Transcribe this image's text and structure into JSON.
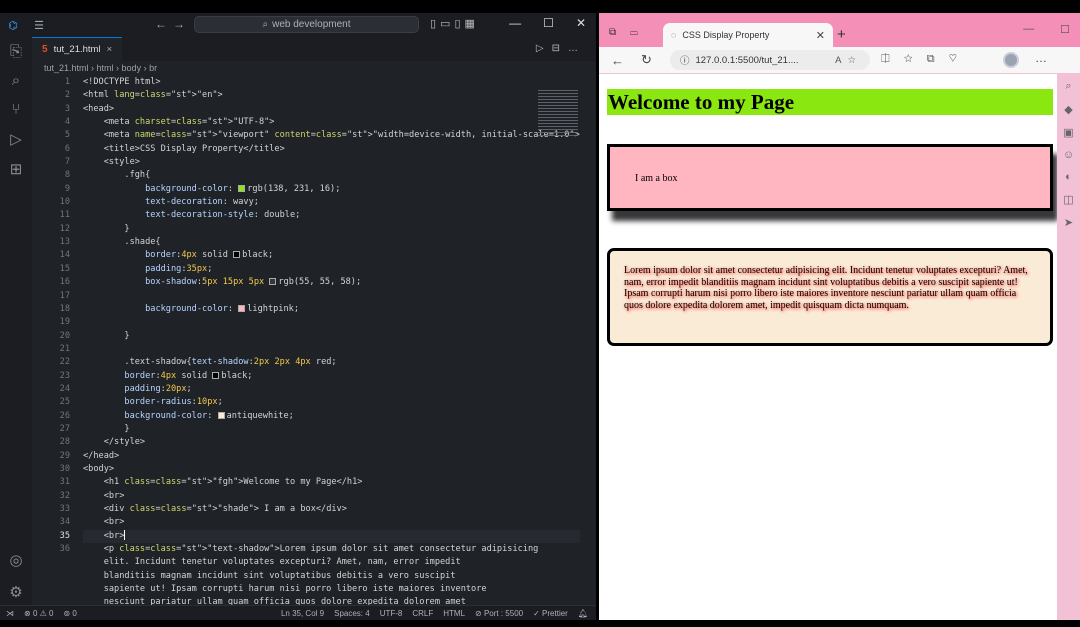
{
  "vscode": {
    "logo": "vscode-logo",
    "search": "web development",
    "tab_label": "tut_21.html",
    "breadcrumb": [
      "tut_21.html",
      "html",
      "body",
      "br"
    ],
    "line_numbers": [
      "1",
      "2",
      "3",
      "4",
      "5",
      "6",
      "7",
      "8",
      "9",
      "10",
      "11",
      "12",
      "13",
      "14",
      "15",
      "16",
      "17",
      "18",
      "19",
      "20",
      "21",
      "22",
      "23",
      "24",
      "25",
      "26",
      "27",
      "28",
      "29",
      "30",
      "31",
      "32",
      "33",
      "34",
      "35",
      "36"
    ],
    "current_line": "35",
    "code": [
      "<!DOCTYPE html>",
      "<html lang=\"en\">",
      "<head>",
      "    <meta charset=\"UTF-8\">",
      "    <meta name=\"viewport\" content=\"width=device-width, initial-scale=1.0\">",
      "    <title>CSS Display Property</title>",
      "    <style>",
      "        .fgh{",
      "            background-color: rgb(138, 231, 16);",
      "            text-decoration: wavy;",
      "            text-decoration-style: double;",
      "        }",
      "        .shade{",
      "            border:4px solid black;",
      "            padding:35px;",
      "            box-shadow:5px 15px 5px rgb(55, 55, 58);",
      "",
      "            background-color: lightpink;",
      "",
      "        }",
      "",
      "        .text-shadow{text-shadow:2px 2px 4px red;",
      "        border:4px solid black;",
      "        padding:20px;",
      "        border-radius:10px;",
      "        background-color: antiquewhite;",
      "        }",
      "    </style>",
      "</head>",
      "<body>",
      "    <h1 class=\"fgh\">Welcome to my Page</h1>",
      "    <br>",
      "    <div class=\"shade\"> I am a box</div>",
      "    <br>",
      "    <br>",
      "    <p class=\"text-shadow\">Lorem ipsum dolor sit amet consectetur adipisicing",
      "    elit. Incidunt tenetur voluptates excepturi? Amet, nam, error impedit",
      "    blanditiis magnam incidunt sint voluptatibus debitis a vero suscipit",
      "    sapiente ut! Ipsam corrupti harum nisi porro libero iste maiores inventore",
      "    nesciunt pariatur ullam quam officia quos dolore expedita dolorem amet"
    ],
    "swatches": {
      "rgb138": "#8ae710",
      "black": "#000000",
      "rgb55": "#37373a",
      "lightpink": "#ffb6c1",
      "red": "#ff0000",
      "antiquewhite": "#faebd7"
    },
    "status": {
      "errors": "0",
      "warnings": "0",
      "ports": "0",
      "position": "Ln 35, Col 9",
      "spaces": "Spaces: 4",
      "encoding": "UTF-8",
      "eol": "CRLF",
      "language": "HTML",
      "port": "Port : 5500",
      "formatter": "Prettier"
    }
  },
  "browser": {
    "tab_title": "CSS Display Property",
    "url": "127.0.0.1:5500/tut_21....",
    "heading": "Welcome to my Page",
    "box_text": "I am a box",
    "paragraph": "Lorem ipsum dolor sit amet consectetur adipisicing elit. Incidunt tenetur voluptates excepturi? Amet, nam, error impedit blanditiis magnam incidunt sint voluptatibus debitis a vero suscipit sapiente ut! Ipsam corrupti harum nisi porro libero iste maiores inventore nesciunt pariatur ullam quam officia quos dolore expedita dolorem amet, impedit quisquam dicta numquam.",
    "colors": {
      "heading_bg": "#8ae710",
      "box_bg": "#ffb6c1",
      "para_bg": "#faebd7",
      "tab_strip": "#f48fb7"
    }
  }
}
